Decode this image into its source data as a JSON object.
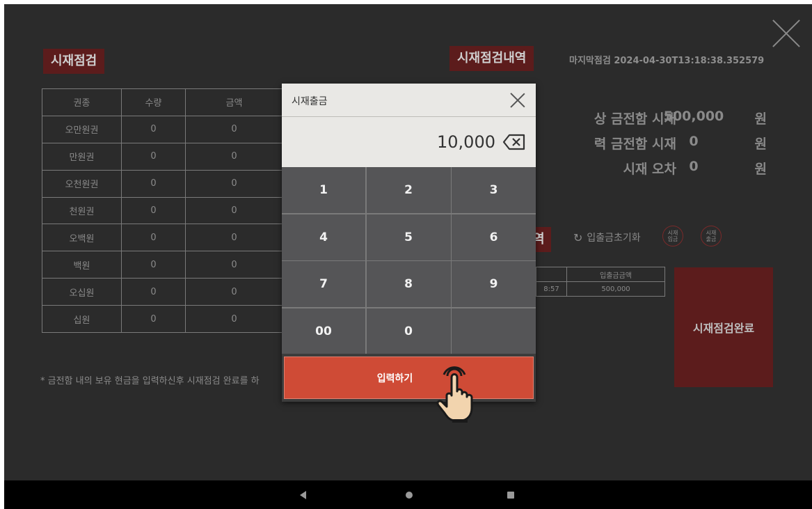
{
  "left_panel": {
    "title": "시재점검",
    "table": {
      "headers": [
        "권종",
        "수량",
        "금액"
      ],
      "rows": [
        [
          "오만원권",
          "0",
          "0"
        ],
        [
          "만원권",
          "0",
          "0"
        ],
        [
          "오천원권",
          "0",
          "0"
        ],
        [
          "천원권",
          "0",
          "0"
        ],
        [
          "오백원",
          "0",
          "0"
        ],
        [
          "백원",
          "0",
          "0"
        ],
        [
          "오십원",
          "0",
          "0"
        ],
        [
          "십원",
          "0",
          "0"
        ]
      ]
    },
    "note": "* 금전함 내의 보유 현금을 입력하신후 시재점검 완료를 하"
  },
  "right_panel": {
    "title": "시재점검내역",
    "last_check": "마지막점검  2024-04-30T13:18:38.352579",
    "summary": [
      {
        "label": "상 금전함 시재",
        "value": "500,000",
        "unit": "원"
      },
      {
        "label": "력 금전함 시재",
        "value": "0",
        "unit": "원"
      },
      {
        "label": "시재 오차",
        "value": "0",
        "unit": "원"
      }
    ],
    "history_badge": "역",
    "reset_label": "입출금초기화",
    "deposit_button": {
      "line1": "시재",
      "line2": "입금"
    },
    "withdraw_button": {
      "line1": "시재",
      "line2": "출금"
    },
    "history_table": {
      "headers": [
        "",
        "입출금금액"
      ],
      "rows": [
        [
          "8:57",
          "500,000"
        ]
      ]
    },
    "complete_button": "시재점검완료"
  },
  "modal": {
    "title": "시재출금",
    "display_value": "10,000",
    "keys": [
      "1",
      "2",
      "3",
      "4",
      "5",
      "6",
      "7",
      "8",
      "9",
      "00",
      "0",
      ""
    ],
    "submit_label": "입력하기"
  },
  "icons": {
    "close": "close-icon",
    "backspace": "backspace-icon",
    "refresh": "refresh-icon",
    "tap": "tap-hand-icon"
  },
  "colors": {
    "background": "#2b2b2b",
    "badge": "#5c1c1c",
    "submit": "#cf4b36",
    "keypad_key": "#555557",
    "modal_header": "#e9e8e5"
  }
}
